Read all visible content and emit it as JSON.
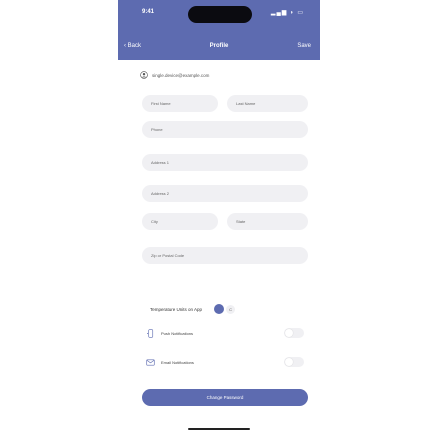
{
  "status": {
    "time": "9:41"
  },
  "nav": {
    "back": "Back",
    "title": "Profile",
    "save": "Save"
  },
  "account": {
    "email": "single.device@example.com"
  },
  "fields": {
    "first_name": "First Name",
    "last_name": "Last Name",
    "phone": "Phone",
    "address1": "Address 1",
    "address2": "Address 2",
    "city": "City",
    "state": "State",
    "zip": "Zip or Postal Code"
  },
  "temperature": {
    "label": "Temperature Units on App",
    "options": [
      "F",
      "C"
    ],
    "selected": "F"
  },
  "toggles": {
    "push": {
      "label": "Push Notifications",
      "enabled": false
    },
    "email": {
      "label": "Email Notifications",
      "enabled": false
    }
  },
  "change_password": "Change Password",
  "colors": {
    "accent": "#5d6bb0",
    "field_bg": "#f0f0f3"
  }
}
